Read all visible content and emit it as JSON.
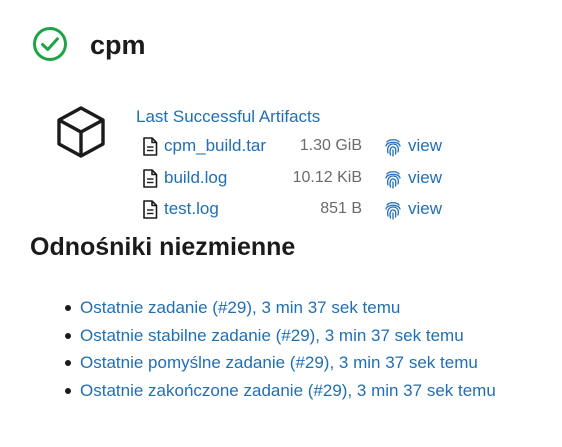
{
  "job": {
    "title": "cpm",
    "status": "success",
    "status_color": "#1ea446"
  },
  "artifacts": {
    "heading": "Last Successful Artifacts",
    "items": [
      {
        "name": "cpm_build.tar",
        "size": "1.30 GiB",
        "view": "view"
      },
      {
        "name": "build.log",
        "size": "10.12 KiB",
        "view": "view"
      },
      {
        "name": "test.log",
        "size": "851 B",
        "view": "view"
      }
    ]
  },
  "permalinks": {
    "heading": "Odnośniki niezmienne",
    "items": [
      "Ostatnie zadanie (#29), 3 min 37 sek temu",
      "Ostatnie stabilne zadanie (#29), 3 min 37 sek temu",
      "Ostatnie pomyślne zadanie (#29), 3 min 37 sek temu",
      "Ostatnie zakończone zadanie (#29), 3 min 37 sek temu"
    ]
  },
  "colors": {
    "link": "#1f6fb5",
    "text": "#1b1b1b",
    "muted": "#6b6b6b",
    "success": "#1ea446"
  },
  "icons": {
    "status": "check-circle-icon",
    "artifacts": "package-cube-icon",
    "file": "file-icon",
    "fingerprint": "fingerprint-icon"
  }
}
